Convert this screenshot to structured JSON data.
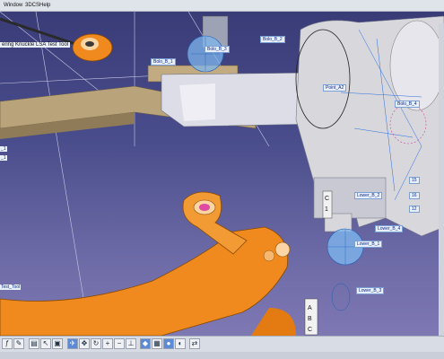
{
  "menu": {
    "window": "Window",
    "three_dcs": "3DCS",
    "help": "Help"
  },
  "tree": {
    "title": "ering Knuckle LSA Test Tool"
  },
  "left_labels": [
    "_1",
    "_1",
    "Test_Tool"
  ],
  "callouts": {
    "bolo_b_3": "Bolo_B_3",
    "bolo_b_2": "Bolo_B_2",
    "bolo_b_1": "Bolo_B_1",
    "point_a2": "Point_A2",
    "bolo_b_4": "Bolo_B_4",
    "lower_b_2": "Lower_B_2",
    "lower_b_4": "Lower_B_4",
    "lower_b_1": "Lower_B_1",
    "lower_b_3": "Lower_B_3",
    "n15": "15",
    "n16": "16",
    "n12": "12"
  },
  "colors": {
    "viewport_top": "#3a3c78",
    "part_orange": "#f08a1e",
    "knuckle_grey": "#d7d7dc",
    "beam_tan": "#b9a37a",
    "callout_blue": "#0b2b8e"
  },
  "toolbar_icons": [
    "fx-icon",
    "sketch-icon",
    "measure-icon",
    "select-icon",
    "box-icon",
    "fly-icon",
    "pan-icon",
    "rotate-icon",
    "zoom-in-icon",
    "zoom-out-icon",
    "normal-view-icon",
    "iso-view-icon",
    "multi-view-icon",
    "render-icon",
    "hide-show-icon",
    "swap-icon",
    "camera-icon"
  ]
}
